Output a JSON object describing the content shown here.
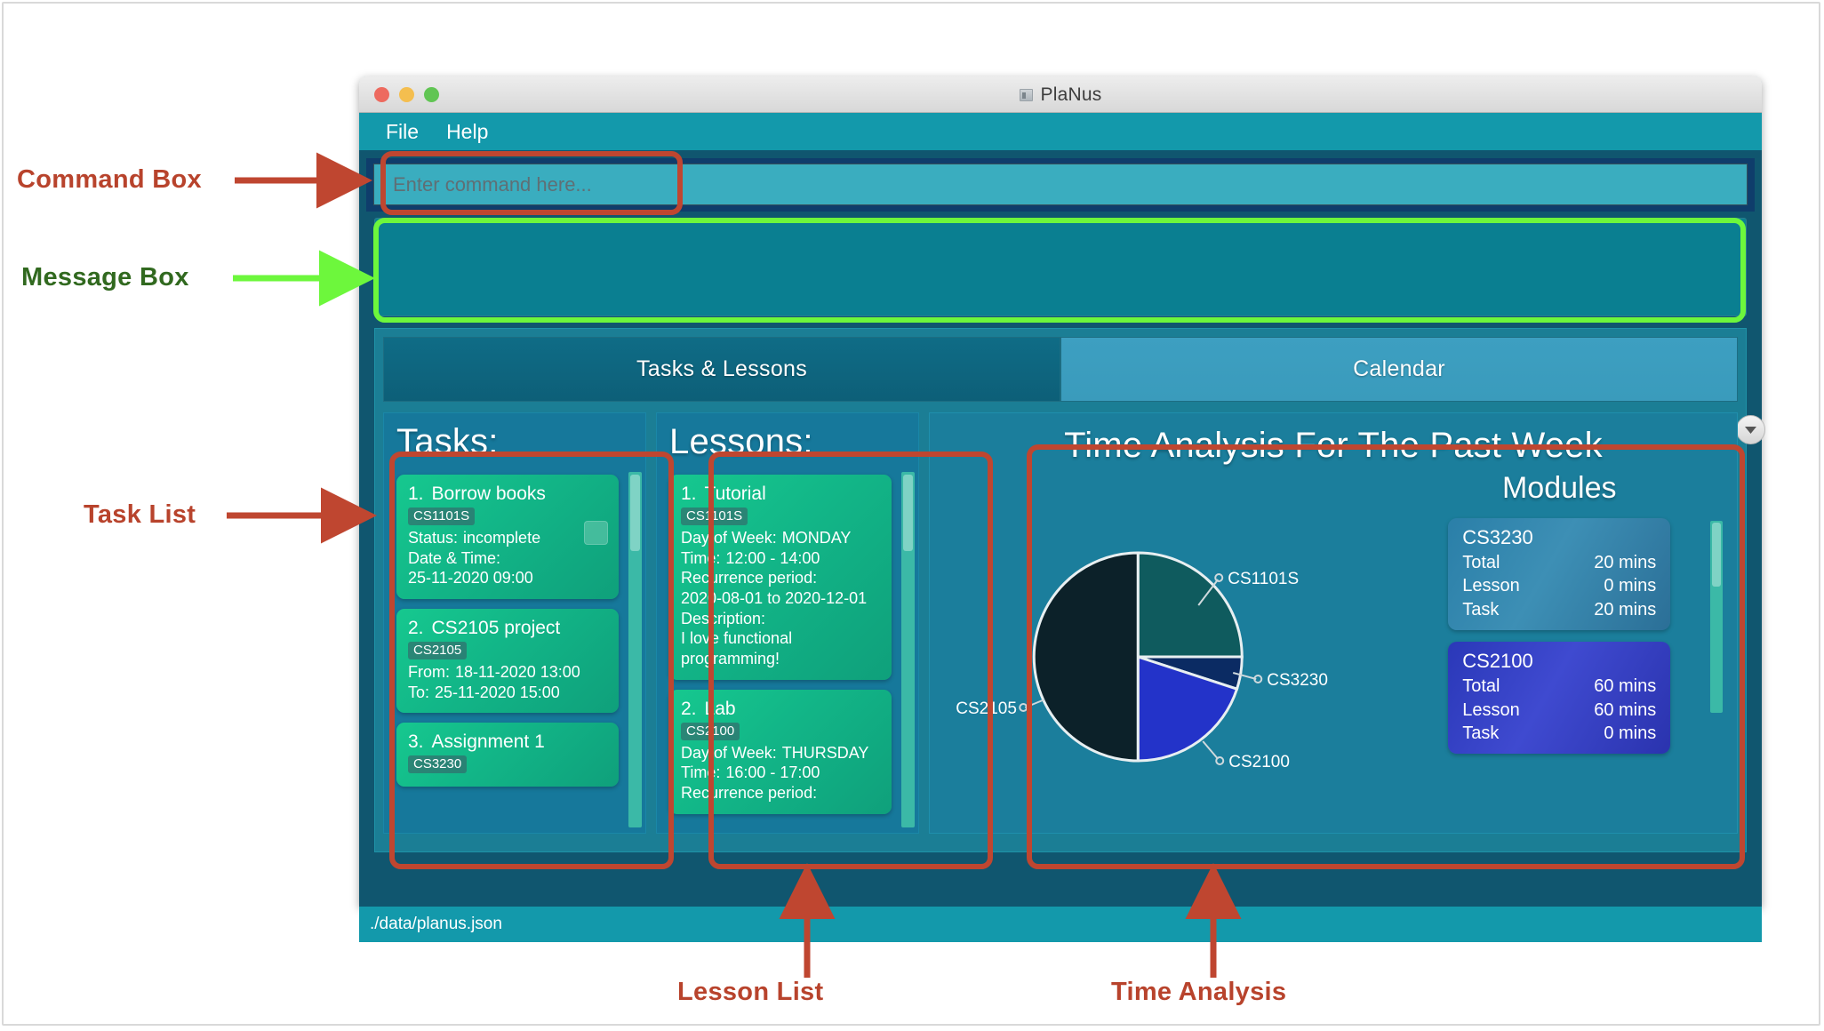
{
  "window": {
    "title": "PlaNus",
    "title_icon": "app-icon",
    "traffic_lights": [
      "close",
      "minimize",
      "maximize"
    ]
  },
  "menubar": {
    "items": [
      {
        "label": "File"
      },
      {
        "label": "Help"
      }
    ]
  },
  "command_box": {
    "placeholder": "Enter command here...",
    "value": ""
  },
  "message_box": {
    "text": ""
  },
  "tabs": [
    {
      "label": "Tasks & Lessons",
      "active": true
    },
    {
      "label": "Calendar",
      "active": false
    }
  ],
  "tab_overflow_icon": "chevron-down-icon",
  "task_list": {
    "title": "Tasks:",
    "items": [
      {
        "index": "1.",
        "name": "Borrow books",
        "module": "CS1101S",
        "lines": [
          {
            "label": "Status:",
            "value": "incomplete"
          },
          {
            "label": "Date & Time:",
            "value": ""
          },
          {
            "label": "",
            "value": "25-11-2020 09:00"
          }
        ],
        "has_checkbox": true
      },
      {
        "index": "2.",
        "name": "CS2105 project",
        "module": "CS2105",
        "lines": [
          {
            "label": "From:",
            "value": "18-11-2020 13:00"
          },
          {
            "label": "To:",
            "value": "25-11-2020 15:00"
          }
        ],
        "has_checkbox": false
      },
      {
        "index": "3.",
        "name": "Assignment 1",
        "module": "CS3230",
        "lines": [],
        "has_checkbox": false
      }
    ]
  },
  "lesson_list": {
    "title": "Lessons:",
    "items": [
      {
        "index": "1.",
        "name": "Tutorial",
        "module": "CS1101S",
        "lines": [
          {
            "label": "Day of Week:",
            "value": "MONDAY"
          },
          {
            "label": "Time:",
            "value": "12:00 - 14:00"
          },
          {
            "label": "Recurrence period:",
            "value": ""
          },
          {
            "label": "",
            "value": "2020-08-01 to 2020-12-01"
          },
          {
            "label": "Description:",
            "value": ""
          },
          {
            "label": "",
            "value": "I love functional programming!"
          }
        ]
      },
      {
        "index": "2.",
        "name": "Lab",
        "module": "CS2100",
        "lines": [
          {
            "label": "Day of Week:",
            "value": "THURSDAY"
          },
          {
            "label": "Time:",
            "value": "16:00 - 17:00"
          },
          {
            "label": "Recurrence period:",
            "value": ""
          }
        ]
      }
    ]
  },
  "time_analysis": {
    "title": "Time Analysis For The Past Week",
    "modules_heading": "Modules",
    "module_cards": [
      {
        "name": "CS3230",
        "rows": [
          {
            "label": "Total",
            "value": "20 mins"
          },
          {
            "label": "Lesson",
            "value": "0 mins"
          },
          {
            "label": "Task",
            "value": "20 mins"
          }
        ]
      },
      {
        "name": "CS2100",
        "rows": [
          {
            "label": "Total",
            "value": "60 mins"
          },
          {
            "label": "Lesson",
            "value": "60 mins"
          },
          {
            "label": "Task",
            "value": "0 mins"
          }
        ]
      }
    ]
  },
  "chart_data": {
    "type": "pie",
    "title": "Time Analysis For The Past Week",
    "labels": [
      "CS1101S",
      "CS3230",
      "CS2100",
      "CS2105"
    ],
    "values": [
      25,
      5,
      20,
      50
    ],
    "unit": "percent",
    "colors": [
      "#0f5b5e",
      "#0b2b63",
      "#2333c9",
      "#0c2129"
    ],
    "legend": "callout-labels",
    "label_positions": [
      "top-right",
      "right",
      "bottom-right",
      "left"
    ]
  },
  "statusbar": {
    "path": "./data/planus.json"
  },
  "annotations": [
    {
      "id": "command-box",
      "label": "Command Box",
      "color": "#b8432c"
    },
    {
      "id": "message-box",
      "label": "Message Box",
      "color": "#31691f"
    },
    {
      "id": "task-list",
      "label": "Task List",
      "color": "#b8432c"
    },
    {
      "id": "lesson-list",
      "label": "Lesson List",
      "color": "#b8432c"
    },
    {
      "id": "time-analysis",
      "label": "Time Analysis",
      "color": "#b8432c"
    }
  ]
}
